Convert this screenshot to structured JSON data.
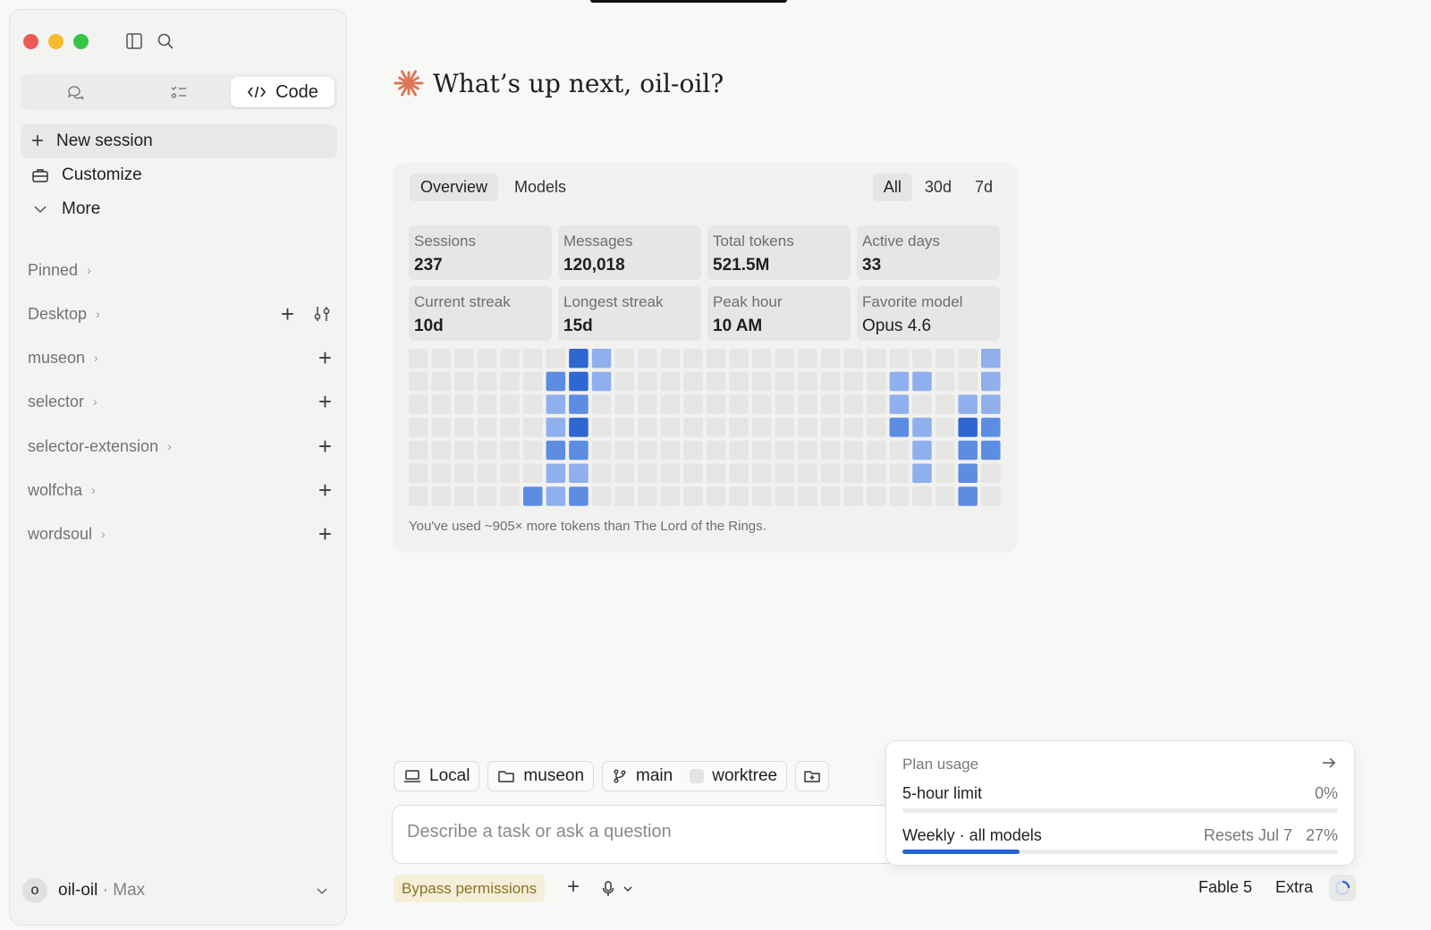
{
  "sidebar": {
    "mode_tabs": {
      "code_label": "Code"
    },
    "nav": [
      {
        "label": "New session"
      },
      {
        "label": "Customize"
      },
      {
        "label": "More"
      }
    ],
    "sections": [
      {
        "label": "Pinned"
      },
      {
        "label": "Desktop"
      },
      {
        "label": "museon"
      },
      {
        "label": "selector"
      },
      {
        "label": "selector-extension"
      },
      {
        "label": "wolfcha"
      },
      {
        "label": "wordsoul"
      }
    ],
    "user": {
      "initial": "o",
      "name": "oil-oil",
      "separator": "·",
      "plan": "Max"
    }
  },
  "main": {
    "greeting": "What’s up next, oil-oil?",
    "card": {
      "tabs": [
        "Overview",
        "Models"
      ],
      "ranges": [
        "All",
        "30d",
        "7d"
      ],
      "stats": [
        {
          "label": "Sessions",
          "value": "237"
        },
        {
          "label": "Messages",
          "value": "120,018"
        },
        {
          "label": "Total tokens",
          "value": "521.5M"
        },
        {
          "label": "Active days",
          "value": "33"
        },
        {
          "label": "Current streak",
          "value": "10d"
        },
        {
          "label": "Longest streak",
          "value": "15d"
        },
        {
          "label": "Peak hour",
          "value": "10 AM"
        },
        {
          "label": "Favorite model",
          "value": "Opus 4.6"
        }
      ],
      "heatmap": {
        "cols": 26,
        "rows": 7,
        "active": [
          [
            7,
            0,
            "dark"
          ],
          [
            8,
            0,
            "light"
          ],
          [
            25,
            0,
            "light"
          ],
          [
            6,
            1,
            "mid"
          ],
          [
            7,
            1,
            "dark"
          ],
          [
            8,
            1,
            "light"
          ],
          [
            21,
            1,
            "light"
          ],
          [
            22,
            1,
            "light"
          ],
          [
            25,
            1,
            "light"
          ],
          [
            6,
            2,
            "light"
          ],
          [
            7,
            2,
            "mid"
          ],
          [
            21,
            2,
            "light"
          ],
          [
            24,
            2,
            "light"
          ],
          [
            25,
            2,
            "light"
          ],
          [
            6,
            3,
            "light"
          ],
          [
            7,
            3,
            "dark"
          ],
          [
            21,
            3,
            "mid"
          ],
          [
            22,
            3,
            "light"
          ],
          [
            24,
            3,
            "dark"
          ],
          [
            25,
            3,
            "mid"
          ],
          [
            6,
            4,
            "mid"
          ],
          [
            7,
            4,
            "mid"
          ],
          [
            22,
            4,
            "light"
          ],
          [
            24,
            4,
            "mid"
          ],
          [
            25,
            4,
            "mid"
          ],
          [
            6,
            5,
            "light"
          ],
          [
            7,
            5,
            "light"
          ],
          [
            22,
            5,
            "light"
          ],
          [
            24,
            5,
            "mid"
          ],
          [
            5,
            6,
            "mid"
          ],
          [
            6,
            6,
            "light"
          ],
          [
            7,
            6,
            "mid"
          ],
          [
            24,
            6,
            "mid"
          ]
        ]
      },
      "footnote": "You've used ~905× more tokens than The Lord of the Rings."
    },
    "context_chips": {
      "local": "Local",
      "folder": "museon",
      "branch": "main",
      "worktree": "worktree"
    },
    "input": {
      "placeholder": "Describe a task or ask a question"
    },
    "bottom": {
      "bypass": "Bypass permissions",
      "model": "Fable 5",
      "extra": "Extra"
    },
    "usage": {
      "title": "Plan usage",
      "five_hour_label": "5-hour limit",
      "five_hour_percent": "0%",
      "five_hour_value": 0,
      "weekly_label": "Weekly · all models",
      "weekly_resets": "Resets Jul 7",
      "weekly_percent": "27%",
      "weekly_value": 0.27
    }
  },
  "colors": {
    "accent_blue": "#2563d4",
    "heat_light": "#8fb0ec",
    "heat_mid": "#5d8de3",
    "heat_dark": "#2f67d2",
    "heat_empty": "#e5e5e3",
    "claude_orange": "#d97757",
    "bypass_bg": "#f5efda"
  }
}
